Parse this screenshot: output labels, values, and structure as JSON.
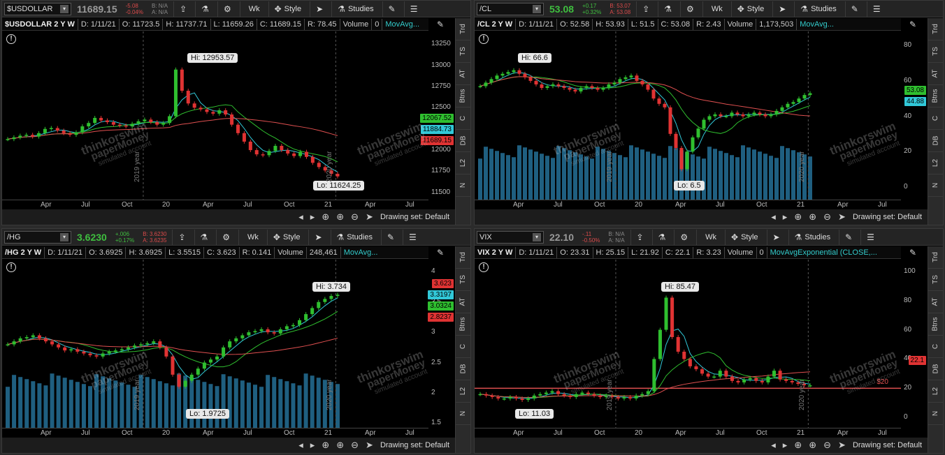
{
  "panels": [
    {
      "id": "usd",
      "symbol": "$USDOLLAR",
      "last": "11689.15",
      "change": "-5.08",
      "change_pct": "-0.04%",
      "bid": "B: N/A",
      "ask": "A: N/A",
      "change_dir": "neg",
      "header": {
        "title": "$USDOLLAR 2 Y W",
        "items": [
          "D: 1/11/21",
          "O: 11723.5",
          "H: 11737.71",
          "L: 11659.26",
          "C: 11689.15",
          "R: 78.45",
          "Volume",
          "0"
        ],
        "study": "MovAvg..."
      },
      "y_ticks": [
        "13250",
        "13000",
        "12750",
        "12500",
        "12250",
        "12000",
        "11750",
        "11500"
      ],
      "x_ticks": [
        "Apr",
        "Jul",
        "Oct",
        "20",
        "Apr",
        "Jul",
        "Oct",
        "21",
        "Apr",
        "Jul"
      ],
      "tags": [
        {
          "text": "12067.52",
          "color": "#2fbf2f"
        },
        {
          "text": "11884.73",
          "color": "#31c8d8"
        },
        {
          "text": "11689.15",
          "color": "#e03333"
        }
      ],
      "hi": "Hi: 12953.57",
      "lo": "Lo: 11624.25",
      "year_labels": [
        "2019 year",
        "2020 year"
      ],
      "drawing_set": "Drawing set: Default"
    },
    {
      "id": "cl",
      "symbol": "/CL",
      "last": "53.08",
      "change": "+0.17",
      "change_pct": "+0.32%",
      "bid": "B: 53.07",
      "ask": "A: 53.08",
      "change_dir": "pos",
      "header": {
        "title": "/CL 2 Y W",
        "items": [
          "D: 1/11/21",
          "O: 52.58",
          "H: 53.93",
          "L: 51.5",
          "C: 53.08",
          "R: 2.43",
          "Volume",
          "1,173,503"
        ],
        "study": "MovAvg..."
      },
      "y_ticks": [
        "80",
        "60",
        "40",
        "20",
        "0"
      ],
      "x_ticks": [
        "Apr",
        "Jul",
        "Oct",
        "20",
        "Apr",
        "Jul",
        "Oct",
        "21",
        "Apr",
        "Jul"
      ],
      "tags": [
        {
          "text": "53.08",
          "color": "#2fbf2f"
        },
        {
          "text": "44.88",
          "color": "#31c8d8"
        }
      ],
      "hi": "Hi: 66.6",
      "lo": "Lo: 6.5",
      "year_labels": [
        "2019 year",
        "2020 year"
      ],
      "drawing_set": "Drawing set: Default"
    },
    {
      "id": "hg",
      "symbol": "/HG",
      "last": "3.6230",
      "change": "+.006",
      "change_pct": "+0.17%",
      "bid": "B: 3.6230",
      "ask": "A: 3.6235",
      "change_dir": "pos",
      "header": {
        "title": "/HG 2 Y W",
        "items": [
          "D: 1/11/21",
          "O: 3.6925",
          "H: 3.6925",
          "L: 3.5515",
          "C: 3.623",
          "R: 0.141",
          "Volume",
          "248,461"
        ],
        "study": "MovAvg..."
      },
      "y_ticks": [
        "4",
        "3.5",
        "3",
        "2.5",
        "2",
        "1.5"
      ],
      "x_ticks": [
        "Apr",
        "Jul",
        "Oct",
        "20",
        "Apr",
        "Jul",
        "Oct",
        "21",
        "Apr",
        "Jul"
      ],
      "tags": [
        {
          "text": "3.623",
          "color": "#e03333"
        },
        {
          "text": "3.3197",
          "color": "#31c8d8"
        },
        {
          "text": "3.0324",
          "color": "#2fbf2f"
        },
        {
          "text": "2.8237",
          "color": "#e03333"
        }
      ],
      "hi": "Hi: 3.734",
      "lo": "Lo: 1.9725",
      "year_labels": [
        "2019 year",
        "2020 year"
      ],
      "drawing_set": "Drawing set: Default"
    },
    {
      "id": "vix",
      "symbol": "VIX",
      "last": "22.10",
      "change": "-.11",
      "change_pct": "-0.50%",
      "bid": "B: N/A",
      "ask": "A: N/A",
      "change_dir": "neg",
      "header": {
        "title": "VIX 2 Y W",
        "items": [
          "D: 1/11/21",
          "O: 23.31",
          "H: 25.15",
          "L: 21.92",
          "C: 22.1",
          "R: 3.23",
          "Volume",
          "0"
        ],
        "study": "MovAvgExponential (CLOSE,..."
      },
      "y_ticks": [
        "100",
        "80",
        "60",
        "40",
        "20",
        "0"
      ],
      "x_ticks": [
        "Apr",
        "Jul",
        "Oct",
        "20",
        "Apr",
        "Jul",
        "Oct",
        "21",
        "Apr",
        "Jul"
      ],
      "tags": [
        {
          "text": "22.1",
          "color": "#e03333"
        }
      ],
      "hi": "Hi: 85.47",
      "lo": "Lo: 11.03",
      "year_labels": [
        "2019 year",
        "2020 year"
      ],
      "hline_label": "$20",
      "drawing_set": "Drawing set: Default"
    }
  ],
  "toolbar": {
    "wk": "Wk",
    "style": "Style",
    "studies": "Studies"
  },
  "side_tabs": [
    "Trd",
    "TS",
    "AT",
    "Btns",
    "C",
    "DB",
    "L2",
    "N"
  ],
  "watermark": {
    "line1": "thinkorswim",
    "line2": "paperMoney",
    "line3": "simulated account"
  },
  "colors": {
    "up": "#2fbf2f",
    "down": "#e03333",
    "ma_fast": "#31c8d8",
    "ma_mid": "#2fbf2f",
    "ma_slow": "#e05050",
    "volume": "#1f5f80"
  },
  "chart_data": [
    {
      "type": "candlestick",
      "title": "$USDOLLAR 2 Y W",
      "ylim": [
        11400,
        13400
      ],
      "close": [
        12130,
        12150,
        12170,
        12180,
        12160,
        12200,
        12250,
        12260,
        12230,
        12200,
        12180,
        12210,
        12280,
        12320,
        12380,
        12350,
        12330,
        12300,
        12290,
        12280,
        12310,
        12340,
        12360,
        12330,
        12300,
        12320,
        12400,
        12950,
        12700,
        12550,
        12500,
        12480,
        12450,
        12430,
        12470,
        12420,
        12300,
        12200,
        12100,
        12000,
        11950,
        11940,
        11990,
        12050,
        12000,
        11960,
        11930,
        11980,
        11920,
        11850,
        11800,
        11760,
        11720,
        11690
      ],
      "hi": 12953.57,
      "lo": 11624.25
    },
    {
      "type": "candlestick",
      "title": "/CL 2 Y W",
      "ylim": [
        -8,
        88
      ],
      "close": [
        57,
        59,
        61,
        63,
        64,
        65,
        66,
        64,
        62,
        60,
        58,
        56,
        57,
        58,
        57,
        56,
        55,
        54,
        56,
        57,
        56,
        55,
        56,
        58,
        59,
        61,
        62,
        63,
        60,
        58,
        55,
        50,
        47,
        45,
        30,
        22,
        10,
        20,
        28,
        33,
        38,
        40,
        41,
        40,
        40,
        42,
        41,
        40,
        41,
        42,
        41,
        40,
        41,
        43,
        45,
        47,
        48,
        50,
        52,
        53
      ],
      "hi": 66.6,
      "lo": 6.5
    },
    {
      "type": "candlestick",
      "title": "/HG 2 Y W",
      "ylim": [
        1.4,
        4.2
      ],
      "close": [
        2.8,
        2.85,
        2.9,
        2.92,
        2.95,
        2.9,
        2.85,
        2.8,
        2.75,
        2.7,
        2.72,
        2.68,
        2.65,
        2.62,
        2.6,
        2.65,
        2.68,
        2.7,
        2.72,
        2.75,
        2.78,
        2.8,
        2.82,
        2.85,
        2.75,
        2.6,
        2.3,
        2.1,
        2.2,
        2.3,
        2.4,
        2.5,
        2.55,
        2.6,
        2.75,
        2.85,
        2.9,
        2.95,
        3.0,
        3.02,
        3.05,
        3.0,
        2.98,
        3.05,
        3.1,
        3.12,
        3.2,
        3.3,
        3.4,
        3.5,
        3.55,
        3.6,
        3.62
      ],
      "hi": 3.734,
      "lo": 1.9725
    },
    {
      "type": "candlestick",
      "title": "VIX 2 Y W",
      "ylim": [
        -8,
        108
      ],
      "close": [
        16,
        15,
        14,
        13,
        13,
        14,
        13,
        12,
        13,
        15,
        16,
        17,
        18,
        16,
        15,
        14,
        16,
        17,
        16,
        15,
        14,
        15,
        14,
        13,
        14,
        13,
        15,
        16,
        18,
        40,
        60,
        82,
        55,
        45,
        40,
        35,
        33,
        30,
        28,
        28,
        32,
        28,
        25,
        24,
        26,
        27,
        25,
        24,
        28,
        32,
        26,
        25,
        24,
        23,
        22,
        22
      ],
      "hi": 85.47,
      "lo": 11.03,
      "hline": 20
    }
  ]
}
